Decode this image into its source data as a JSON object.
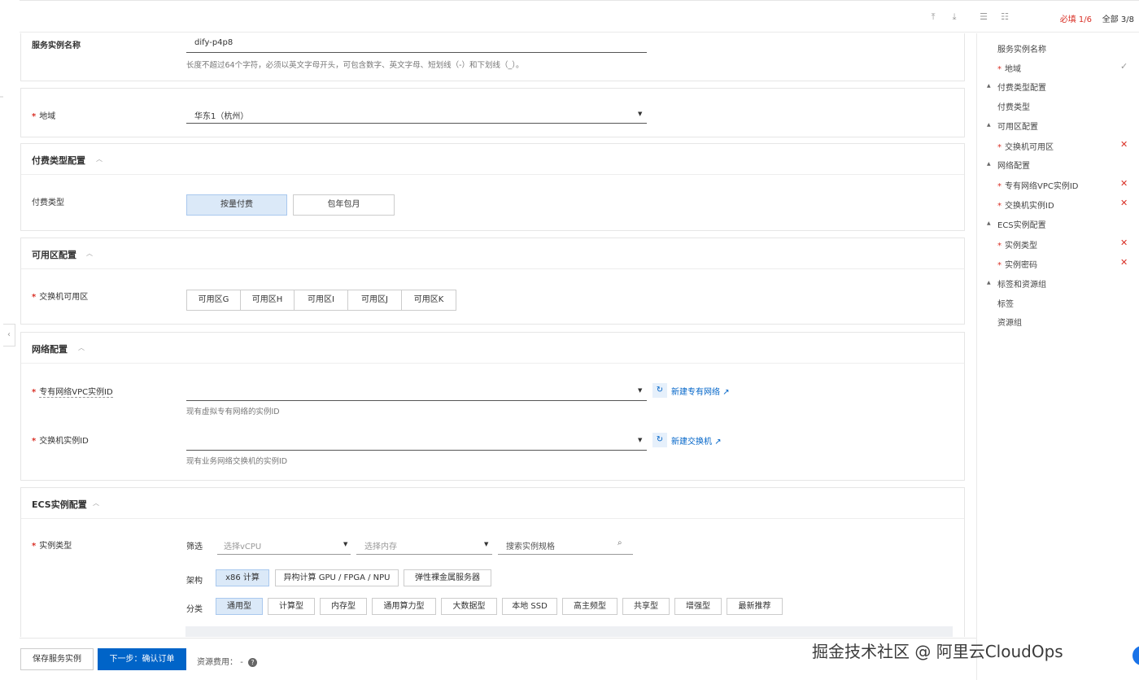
{
  "toolbar": {
    "icons": [
      "to-top-icon",
      "to-bottom-icon",
      "expand-all-icon",
      "collapse-all-icon"
    ],
    "required_label": "必填",
    "required_count": "1/6",
    "all_label": "全部",
    "all_count": "3/8"
  },
  "form": {
    "instance_name": {
      "label": "服务实例名称",
      "value": "dify-p4p8",
      "help": "长度不超过64个字符，必须以英文字母开头，可包含数字、英文字母、短划线（-）和下划线（_）。"
    },
    "region": {
      "label": "地域",
      "value": "华东1（杭州）"
    },
    "billing": {
      "section_title": "付费类型配置",
      "label": "付费类型",
      "options": [
        "按量付费",
        "包年包月"
      ],
      "selected": "按量付费"
    },
    "zone": {
      "section_title": "可用区配置",
      "label": "交换机可用区",
      "options": [
        "可用区G",
        "可用区H",
        "可用区I",
        "可用区J",
        "可用区K"
      ]
    },
    "network": {
      "section_title": "网络配置",
      "vpc_label": "专有网络VPC实例ID",
      "vpc_help": "现有虚拟专有网络的实例ID",
      "vpc_link": "新建专有网络",
      "vswitch_label": "交换机实例ID",
      "vswitch_help": "现有业务网络交换机的实例ID",
      "vswitch_link": "新建交换机"
    },
    "ecs": {
      "section_title": "ECS实例配置",
      "label": "实例类型",
      "filter_label": "筛选",
      "vcpu_placeholder": "选择vCPU",
      "memory_placeholder": "选择内存",
      "search_placeholder": "搜索实例规格",
      "arch_label": "架构",
      "arch_options": [
        "x86 计算",
        "异构计算 GPU / FPGA / NPU",
        "弹性裸金属服务器"
      ],
      "arch_selected": "x86 计算",
      "category_label": "分类",
      "category_options": [
        "通用型",
        "计算型",
        "内存型",
        "通用算力型",
        "大数据型",
        "本地 SSD",
        "高主频型",
        "共享型",
        "增强型",
        "最新推荐"
      ],
      "category_selected": "通用型"
    }
  },
  "nav": {
    "items": [
      {
        "label": "服务实例名称",
        "required": false,
        "group": false,
        "status": ""
      },
      {
        "label": "地域",
        "required": true,
        "group": false,
        "status": "ok"
      },
      {
        "label": "付费类型配置",
        "required": false,
        "group": true,
        "status": ""
      },
      {
        "label": "付费类型",
        "required": false,
        "group": false,
        "status": ""
      },
      {
        "label": "可用区配置",
        "required": false,
        "group": true,
        "status": ""
      },
      {
        "label": "交换机可用区",
        "required": true,
        "group": false,
        "status": "error"
      },
      {
        "label": "网络配置",
        "required": false,
        "group": true,
        "status": ""
      },
      {
        "label": "专有网络VPC实例ID",
        "required": true,
        "group": false,
        "status": "error"
      },
      {
        "label": "交换机实例ID",
        "required": true,
        "group": false,
        "status": "error"
      },
      {
        "label": "ECS实例配置",
        "required": false,
        "group": true,
        "status": ""
      },
      {
        "label": "实例类型",
        "required": true,
        "group": false,
        "status": "error"
      },
      {
        "label": "实例密码",
        "required": true,
        "group": false,
        "status": "error"
      },
      {
        "label": "标签和资源组",
        "required": false,
        "group": true,
        "status": ""
      },
      {
        "label": "标签",
        "required": false,
        "group": false,
        "status": ""
      },
      {
        "label": "资源组",
        "required": false,
        "group": false,
        "status": ""
      }
    ]
  },
  "footer": {
    "save_label": "保存服务实例",
    "next_label": "下一步：确认订单",
    "cost_label": "资源费用：",
    "cost_value": "-"
  },
  "watermark": "掘金技术社区 @ 阿里云CloudOps",
  "colors": {
    "primary": "#0064c8",
    "required": "#d93026",
    "selected_bg": "#dbe9f8"
  }
}
